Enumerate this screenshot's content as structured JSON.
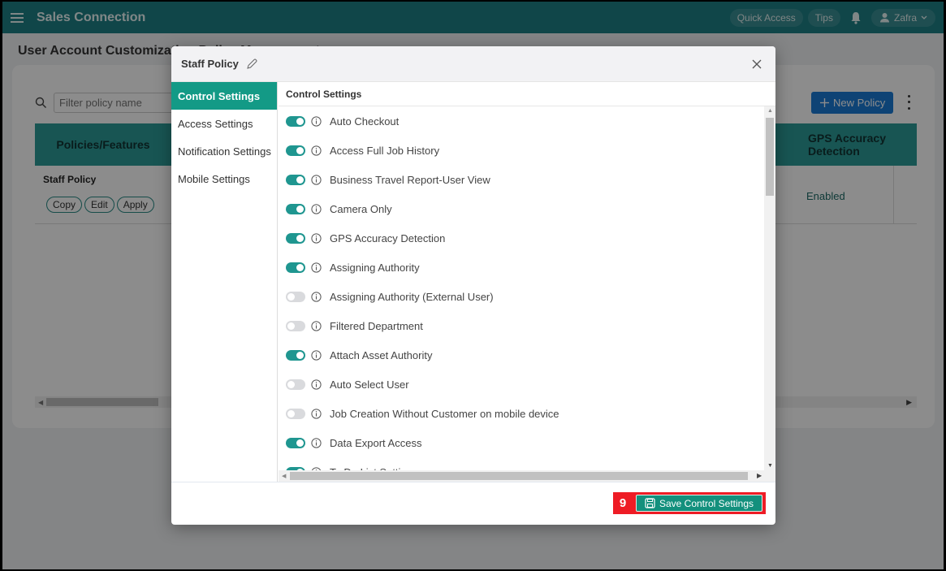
{
  "app": {
    "title": "Sales Connection"
  },
  "topbar": {
    "quick_access": "Quick Access",
    "tips": "Tips",
    "user_name": "Zafra"
  },
  "page": {
    "title": "User Account Customization Policy Management",
    "filter_placeholder": "Filter policy name",
    "new_policy_label": "New Policy",
    "table": {
      "headers": [
        "Policies/Features",
        "GPS Accuracy Detection"
      ],
      "rows": [
        {
          "name": "Staff Policy",
          "actions": [
            "Copy",
            "Edit",
            "Apply"
          ],
          "gps_accuracy_detection": "Enabled"
        }
      ]
    }
  },
  "modal": {
    "title": "Staff Policy",
    "nav": [
      {
        "label": "Control Settings",
        "active": true
      },
      {
        "label": "Access Settings",
        "active": false
      },
      {
        "label": "Notification Settings",
        "active": false
      },
      {
        "label": "Mobile Settings",
        "active": false
      }
    ],
    "section_title": "Control Settings",
    "settings": [
      {
        "label": "Auto Checkout",
        "enabled": true
      },
      {
        "label": "Access Full Job History",
        "enabled": true
      },
      {
        "label": "Business Travel Report-User View",
        "enabled": true
      },
      {
        "label": "Camera Only",
        "enabled": true
      },
      {
        "label": "GPS Accuracy Detection",
        "enabled": true
      },
      {
        "label": "Assigning Authority",
        "enabled": true
      },
      {
        "label": "Assigning Authority (External User)",
        "enabled": false
      },
      {
        "label": "Filtered Department",
        "enabled": false
      },
      {
        "label": "Attach Asset Authority",
        "enabled": true
      },
      {
        "label": "Auto Select User",
        "enabled": false
      },
      {
        "label": "Job Creation Without Customer on mobile device",
        "enabled": false
      },
      {
        "label": "Data Export Access",
        "enabled": true
      },
      {
        "label": "To Do List Settings",
        "enabled": true
      }
    ],
    "save_label": "Save Control Settings",
    "step_badge": "9"
  },
  "colors": {
    "brand": "#1e8086",
    "accent": "#139a86",
    "toggle_on": "#1f9690",
    "toggle_off": "#d9dadd",
    "primary_button": "#1a7ad6",
    "highlight": "#ee1c25"
  }
}
